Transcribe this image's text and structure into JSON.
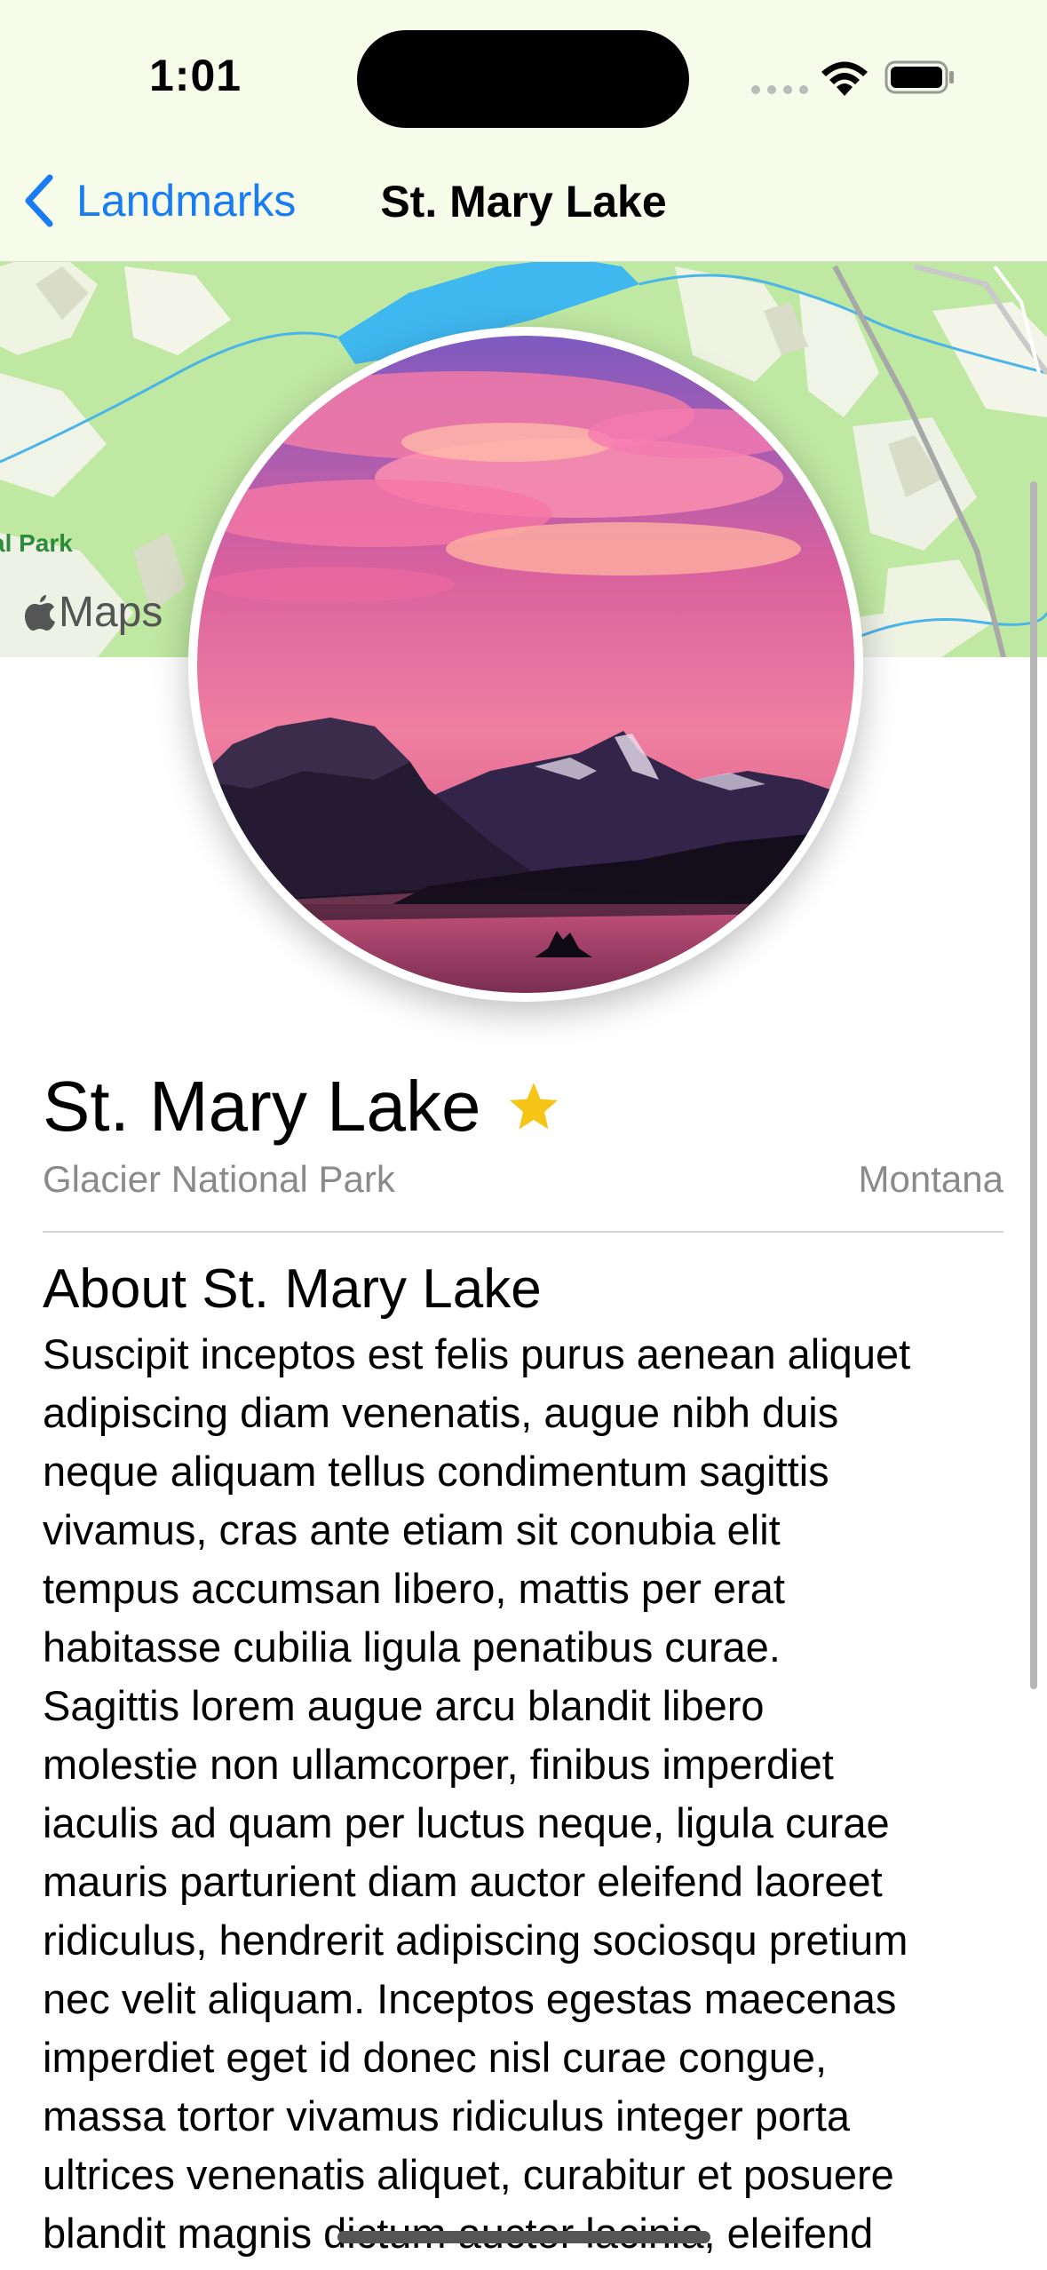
{
  "status_bar": {
    "time": "1:01"
  },
  "nav": {
    "back_label": "Landmarks",
    "title": "St. Mary Lake"
  },
  "map": {
    "attribution": "Maps",
    "park_label": "al Park"
  },
  "landmark": {
    "name": "St. Mary Lake",
    "is_favorite": true,
    "park": "Glacier National Park",
    "state": "Montana",
    "about_heading": "About St. Mary Lake",
    "description_lines": [
      "Suscipit inceptos est felis purus aenean aliquet",
      "adipiscing diam venenatis, augue nibh duis",
      "neque aliquam tellus condimentum sagittis",
      "vivamus, cras ante etiam sit conubia elit",
      "tempus accumsan libero, mattis per erat",
      "habitasse cubilia ligula penatibus curae.",
      "Sagittis lorem augue arcu blandit libero",
      "molestie non ullamcorper, finibus imperdiet",
      "iaculis ad quam per luctus neque, ligula curae",
      "mauris parturient diam auctor eleifend laoreet",
      "ridiculus, hendrerit adipiscing sociosqu pretium",
      "nec velit aliquam. Inceptos egestas maecenas",
      "imperdiet eget id donec nisl curae congue,",
      "massa tortor vivamus ridiculus integer porta",
      "ultrices venenatis aliquet, curabitur et posuere",
      "blandit magnis dictum auctor lacinia, eleifend"
    ]
  },
  "colors": {
    "accent": "#1a7cf5",
    "star": "#f5c518",
    "secondary_text": "#8a8a8e",
    "nav_background": "#f7fcea"
  },
  "icons": {
    "back": "chevron-left-icon",
    "favorite": "star-fill-icon",
    "wifi": "wifi-icon",
    "battery": "battery-icon",
    "maps_logo": "apple-logo-icon"
  }
}
